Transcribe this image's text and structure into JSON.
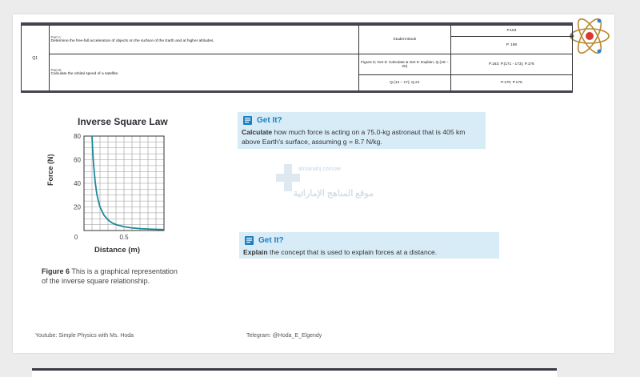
{
  "table": {
    "question": "Q1",
    "part_a_label": "Part A:",
    "part_a_text": "Determine the free-fall acceleration of objects on the surface of the Earth and at higher altitudes.",
    "part_b_label": "Part B:",
    "part_b_text": "Calculate the orbital speed of a satellite.",
    "book_rows": [
      "Student Book",
      "Figure 6; Get It: Calculate & Get It: Explain; Q.(18 – 20)",
      "Q.(14 – 17); Q.21"
    ],
    "page_rows": [
      "P.163",
      "P. 169",
      "P.163; P.(171 - 173); P.176",
      "P.170; P.176"
    ]
  },
  "chart_data": {
    "type": "line",
    "title": "Inverse Square Law",
    "xlabel": "Distance (m)",
    "ylabel": "Force (N)",
    "x_ticks": [
      "0",
      "0.5"
    ],
    "y_ticks": [
      "20",
      "40",
      "60",
      "80"
    ],
    "xlim": [
      0,
      1.0
    ],
    "ylim": [
      0,
      80
    ],
    "grid": true,
    "color": "#1b8a9c",
    "series": [
      {
        "x": [
          0.1,
          0.11,
          0.12,
          0.14,
          0.16,
          0.18,
          0.2,
          0.25,
          0.3,
          0.35,
          0.4,
          0.5,
          0.6,
          0.7,
          0.8,
          0.9,
          1.0
        ],
        "y": [
          80,
          66,
          56,
          41,
          31,
          25,
          20,
          13,
          9,
          6.5,
          5,
          3.2,
          2.2,
          1.6,
          1.25,
          1.0,
          0.8
        ]
      }
    ]
  },
  "figure_caption": {
    "label": "Figure 6",
    "text": "This is a graphical representation of the inverse square relationship."
  },
  "get_it_1": {
    "title": "Get It?",
    "verb": "Calculate",
    "text": " how much force is acting on a 75.0-kg astronaut that is 405 km above Earth's surface, assuming g = 8.7 N/kg."
  },
  "get_it_2": {
    "title": "Get It?",
    "verb": "Explain",
    "text": " the concept that is used to explain forces at a distance."
  },
  "watermark": {
    "url": "almanahj.com/ae",
    "arabic": "موقع المناهج الإماراتية"
  },
  "footer": {
    "youtube": "Youtube: Simple Physics with Ms. Hoda",
    "telegram": "Telegram: @Hoda_E_Elgendy"
  },
  "colors": {
    "accent": "#1b7fc4",
    "box_bg": "#d8ecf7",
    "curve": "#1b8a9c"
  },
  "icons": [
    "atom-logo",
    "notebook-icon"
  ]
}
